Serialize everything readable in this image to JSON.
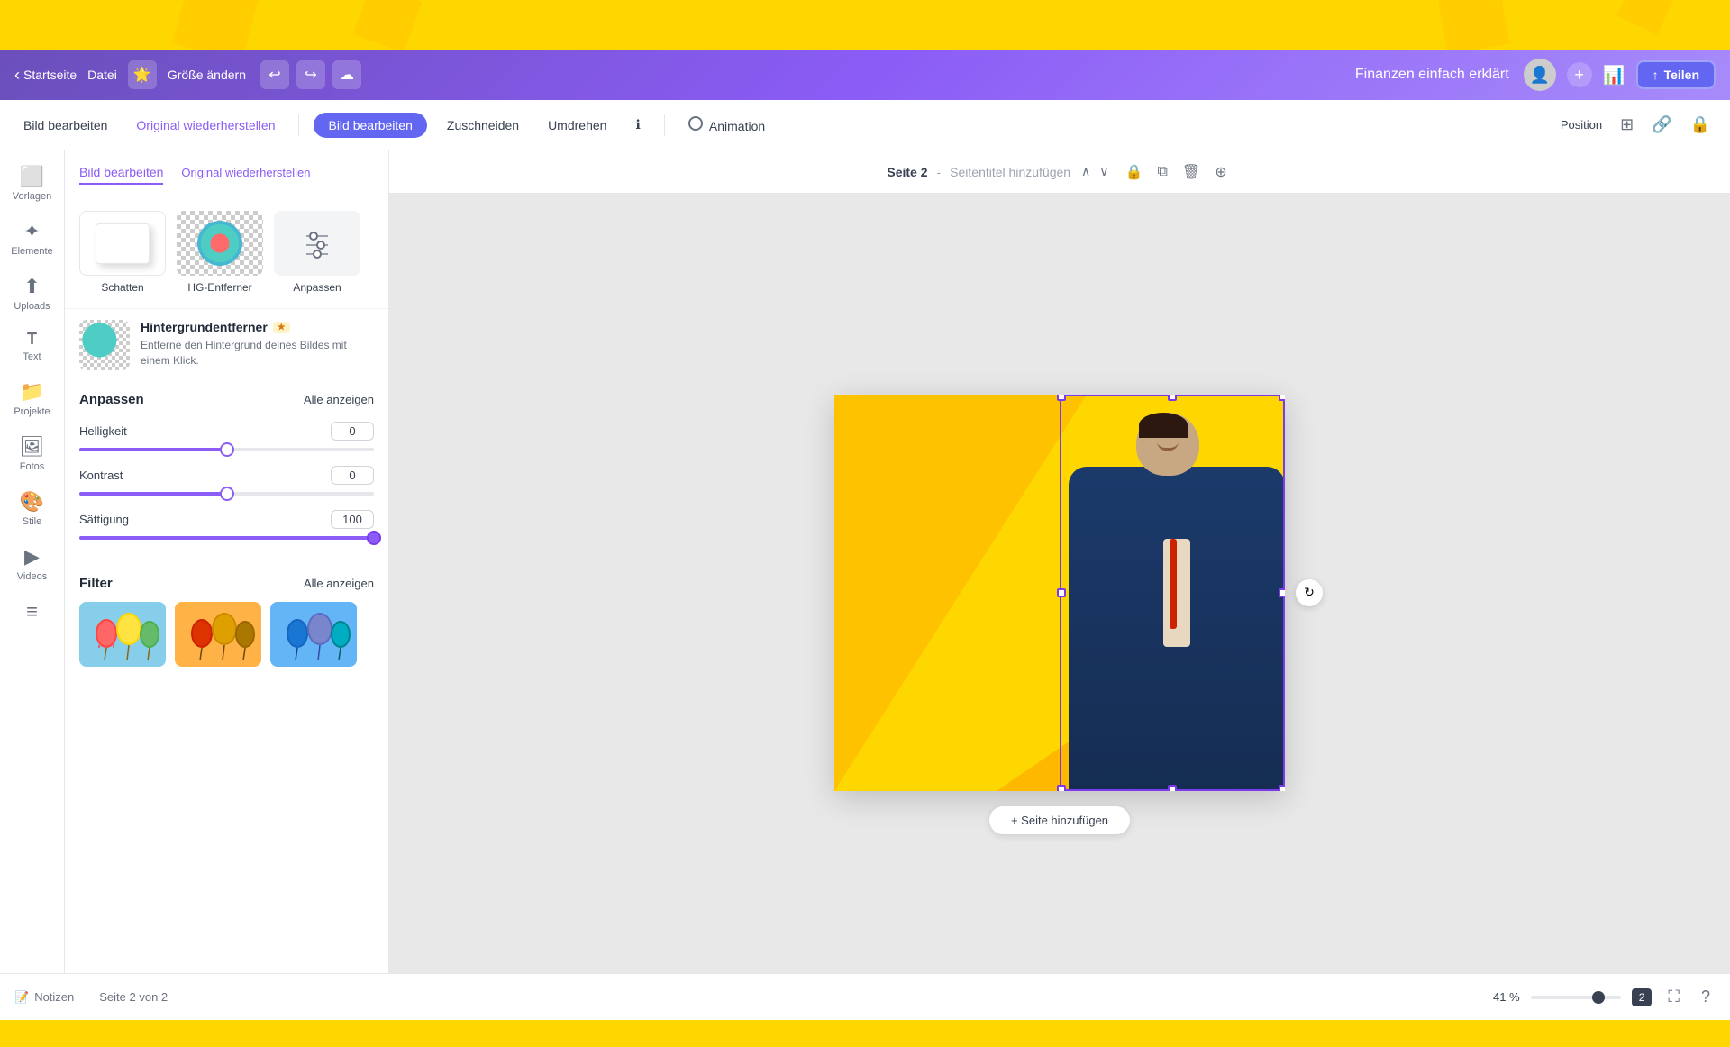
{
  "topBar": {
    "visible": true
  },
  "header": {
    "back_label": "Startseite",
    "nav_label": "Datei",
    "resize_label": "Größe ändern",
    "resize_icon": "🌟",
    "undo_label": "↩",
    "redo_label": "↪",
    "cloud_label": "☁",
    "project_title": "Finanzen einfach erklärt",
    "add_icon": "+",
    "chart_icon": "📊",
    "share_icon": "↑",
    "share_label": "Teilen"
  },
  "toolbar2": {
    "edit_label": "Bild bearbeiten",
    "restore_label": "Original wiederherstellen",
    "edit_active_label": "Bild bearbeiten",
    "crop_label": "Zuschneiden",
    "flip_label": "Umdrehen",
    "info_label": "ℹ",
    "animation_label": "Animation",
    "position_label": "Position"
  },
  "sidebar": {
    "items": [
      {
        "icon": "⬜",
        "label": "Vorlagen"
      },
      {
        "icon": "✦",
        "label": "Elemente"
      },
      {
        "icon": "⬆",
        "label": "Uploads"
      },
      {
        "icon": "T",
        "label": "Text"
      },
      {
        "icon": "📁",
        "label": "Projekte"
      },
      {
        "icon": "🖼",
        "label": "Fotos"
      },
      {
        "icon": "🎨",
        "label": "Stile"
      },
      {
        "icon": "▶",
        "label": "Videos"
      },
      {
        "icon": "≡",
        "label": ""
      }
    ]
  },
  "leftPanel": {
    "edit_tab": "Bild bearbeiten",
    "restore_tab": "Original wiederherstellen",
    "options": [
      {
        "label": "Schatten",
        "type": "shadow"
      },
      {
        "label": "HG-Entferner",
        "type": "bg-remove"
      },
      {
        "label": "Anpassen",
        "type": "adjust"
      }
    ],
    "bgRemover": {
      "title": "Hintergrundentferner",
      "badge": "★",
      "description": "Entferne den Hintergrund deines Bildes mit einem Klick."
    },
    "adjust": {
      "title": "Anpassen",
      "show_all": "Alle anzeigen",
      "sliders": [
        {
          "label": "Helligkeit",
          "value": "0",
          "percent": 50
        },
        {
          "label": "Kontrast",
          "value": "0",
          "percent": 50
        },
        {
          "label": "Sättigung",
          "value": "100",
          "percent": 100
        }
      ]
    },
    "filter": {
      "title": "Filter",
      "show_all": "Alle anzeigen"
    }
  },
  "canvas": {
    "page_label": "Seite 2",
    "page_title_placeholder": "Seitentitel hinzufügen",
    "add_page": "+ Seite hinzufügen"
  },
  "floatingToolbar": {
    "copy_icon": "⧉",
    "delete_icon": "🗑",
    "more_icon": "···"
  },
  "bottomBar": {
    "notes_icon": "📝",
    "notes_label": "Notizen",
    "page_info": "Seite 2 von 2",
    "zoom_level": "41 %",
    "page_badge": "2",
    "fullscreen_icon": "⛶",
    "help_icon": "?"
  }
}
